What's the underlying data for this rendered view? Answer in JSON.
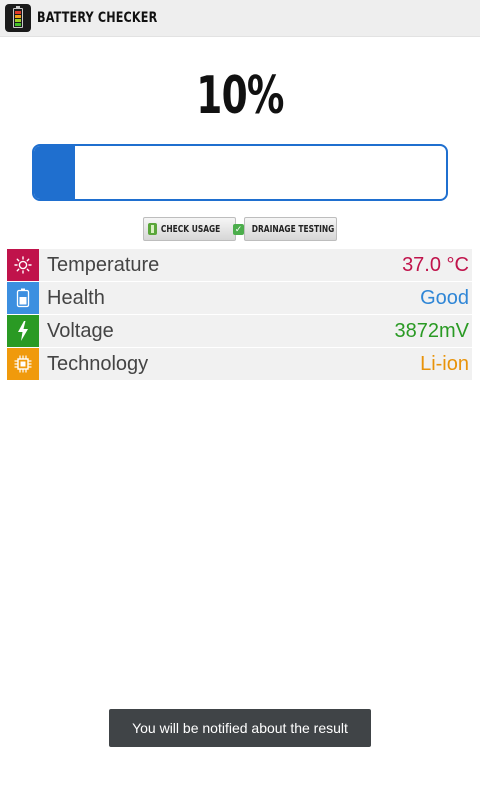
{
  "app": {
    "title": "BATTERY CHECKER",
    "icon": "battery-app-icon"
  },
  "battery": {
    "level_text": "10%",
    "level_fraction": 0.1,
    "bar_color": "#1f6fcf"
  },
  "buttons": {
    "check_usage": {
      "label": "CHECK USAGE",
      "icon": "battery-icon"
    },
    "drainage_testing": {
      "label": "DRAINAGE TESTING",
      "icon": "checkmark-icon"
    }
  },
  "stats": [
    {
      "label": "Temperature",
      "value": "37.0 °C",
      "icon": "sun-icon",
      "icon_color": "#c0134b",
      "value_color": "#c0134b"
    },
    {
      "label": "Health",
      "value": "Good",
      "icon": "battery-icon",
      "icon_color": "#3c8fe0",
      "value_color": "#2f86d6"
    },
    {
      "label": "Voltage",
      "value": "3872mV",
      "icon": "lightning-icon",
      "icon_color": "#2a9a24",
      "value_color": "#2a9a24"
    },
    {
      "label": "Technology",
      "value": "Li-ion",
      "icon": "chip-icon",
      "icon_color": "#f09a0c",
      "value_color": "#e8930a"
    }
  ],
  "toast": {
    "message": "You will be notified about the result"
  }
}
